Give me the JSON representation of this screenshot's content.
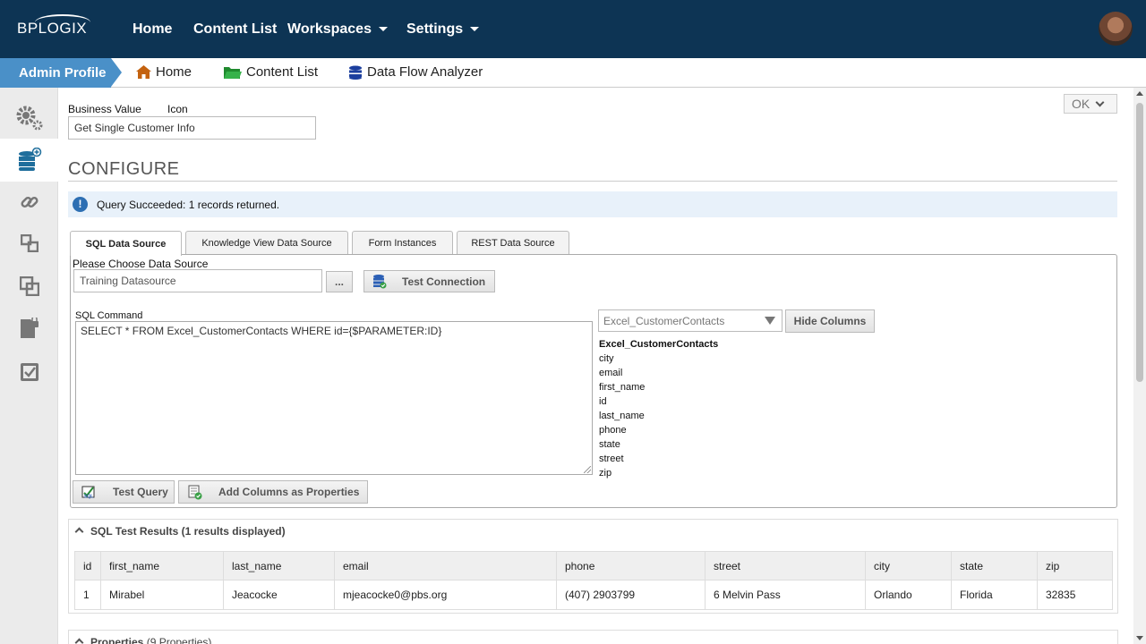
{
  "topnav": {
    "logo": "BPLOGIX",
    "items": [
      {
        "label": "Home"
      },
      {
        "label": "Content List"
      },
      {
        "label": "Workspaces"
      },
      {
        "label": "Settings"
      }
    ]
  },
  "breadcrumb": {
    "root": "Admin Profile",
    "items": [
      {
        "label": "Home",
        "icon": "house-icon"
      },
      {
        "label": "Content List",
        "icon": "folder-icon"
      },
      {
        "label": "Data Flow Analyzer",
        "icon": "database-icon"
      }
    ]
  },
  "sidebar": {
    "items": [
      {
        "icon": "gears-icon"
      },
      {
        "icon": "database-add-icon",
        "active": true
      },
      {
        "icon": "link-icon"
      },
      {
        "icon": "flow-icon"
      },
      {
        "icon": "copy-icon"
      },
      {
        "icon": "locked-file-icon"
      },
      {
        "icon": "checklist-icon"
      }
    ]
  },
  "form": {
    "business_value_label": "Business Value",
    "icon_label": "Icon",
    "business_value": "Get Single Customer Info",
    "ok_label": "OK",
    "section_title": "CONFIGURE",
    "alert_text": "Query Succeeded: 1 records returned."
  },
  "tabs": [
    {
      "label": "SQL Data Source",
      "active": true
    },
    {
      "label": "Knowledge View Data Source"
    },
    {
      "label": "Form Instances"
    },
    {
      "label": "REST Data Source"
    }
  ],
  "sql": {
    "datasource_label": "Please Choose Data Source",
    "datasource_value": "Training Datasource",
    "browse_label": "...",
    "test_connection_label": "Test Connection",
    "command_label": "SQL Command",
    "command_value": "SELECT * FROM Excel_CustomerContacts WHERE id={$PARAMETER:ID}",
    "table_select": "Excel_CustomerContacts",
    "hide_columns_label": "Hide Columns",
    "columns_header": "Excel_CustomerContacts",
    "columns": [
      "city",
      "email",
      "first_name",
      "id",
      "last_name",
      "phone",
      "state",
      "street",
      "zip"
    ],
    "test_query_label": "Test Query",
    "add_columns_label": "Add Columns as Properties"
  },
  "results": {
    "title": "SQL Test Results (1 results displayed)",
    "headers": [
      "id",
      "first_name",
      "last_name",
      "email",
      "phone",
      "street",
      "city",
      "state",
      "zip"
    ],
    "rows": [
      [
        "1",
        "Mirabel",
        "Jeacocke",
        "mjeacocke0@pbs.org",
        "(407) 2903799",
        "6 Melvin Pass",
        "Orlando",
        "Florida",
        "32835"
      ]
    ]
  },
  "properties": {
    "title": "Properties",
    "count": "(9 Properties)"
  },
  "colors": {
    "nav_bg": "#0d3454",
    "crumb_accent": "#4a90c8",
    "alert_bg": "#e8f1fa",
    "info_blue": "#2d6fb3"
  }
}
